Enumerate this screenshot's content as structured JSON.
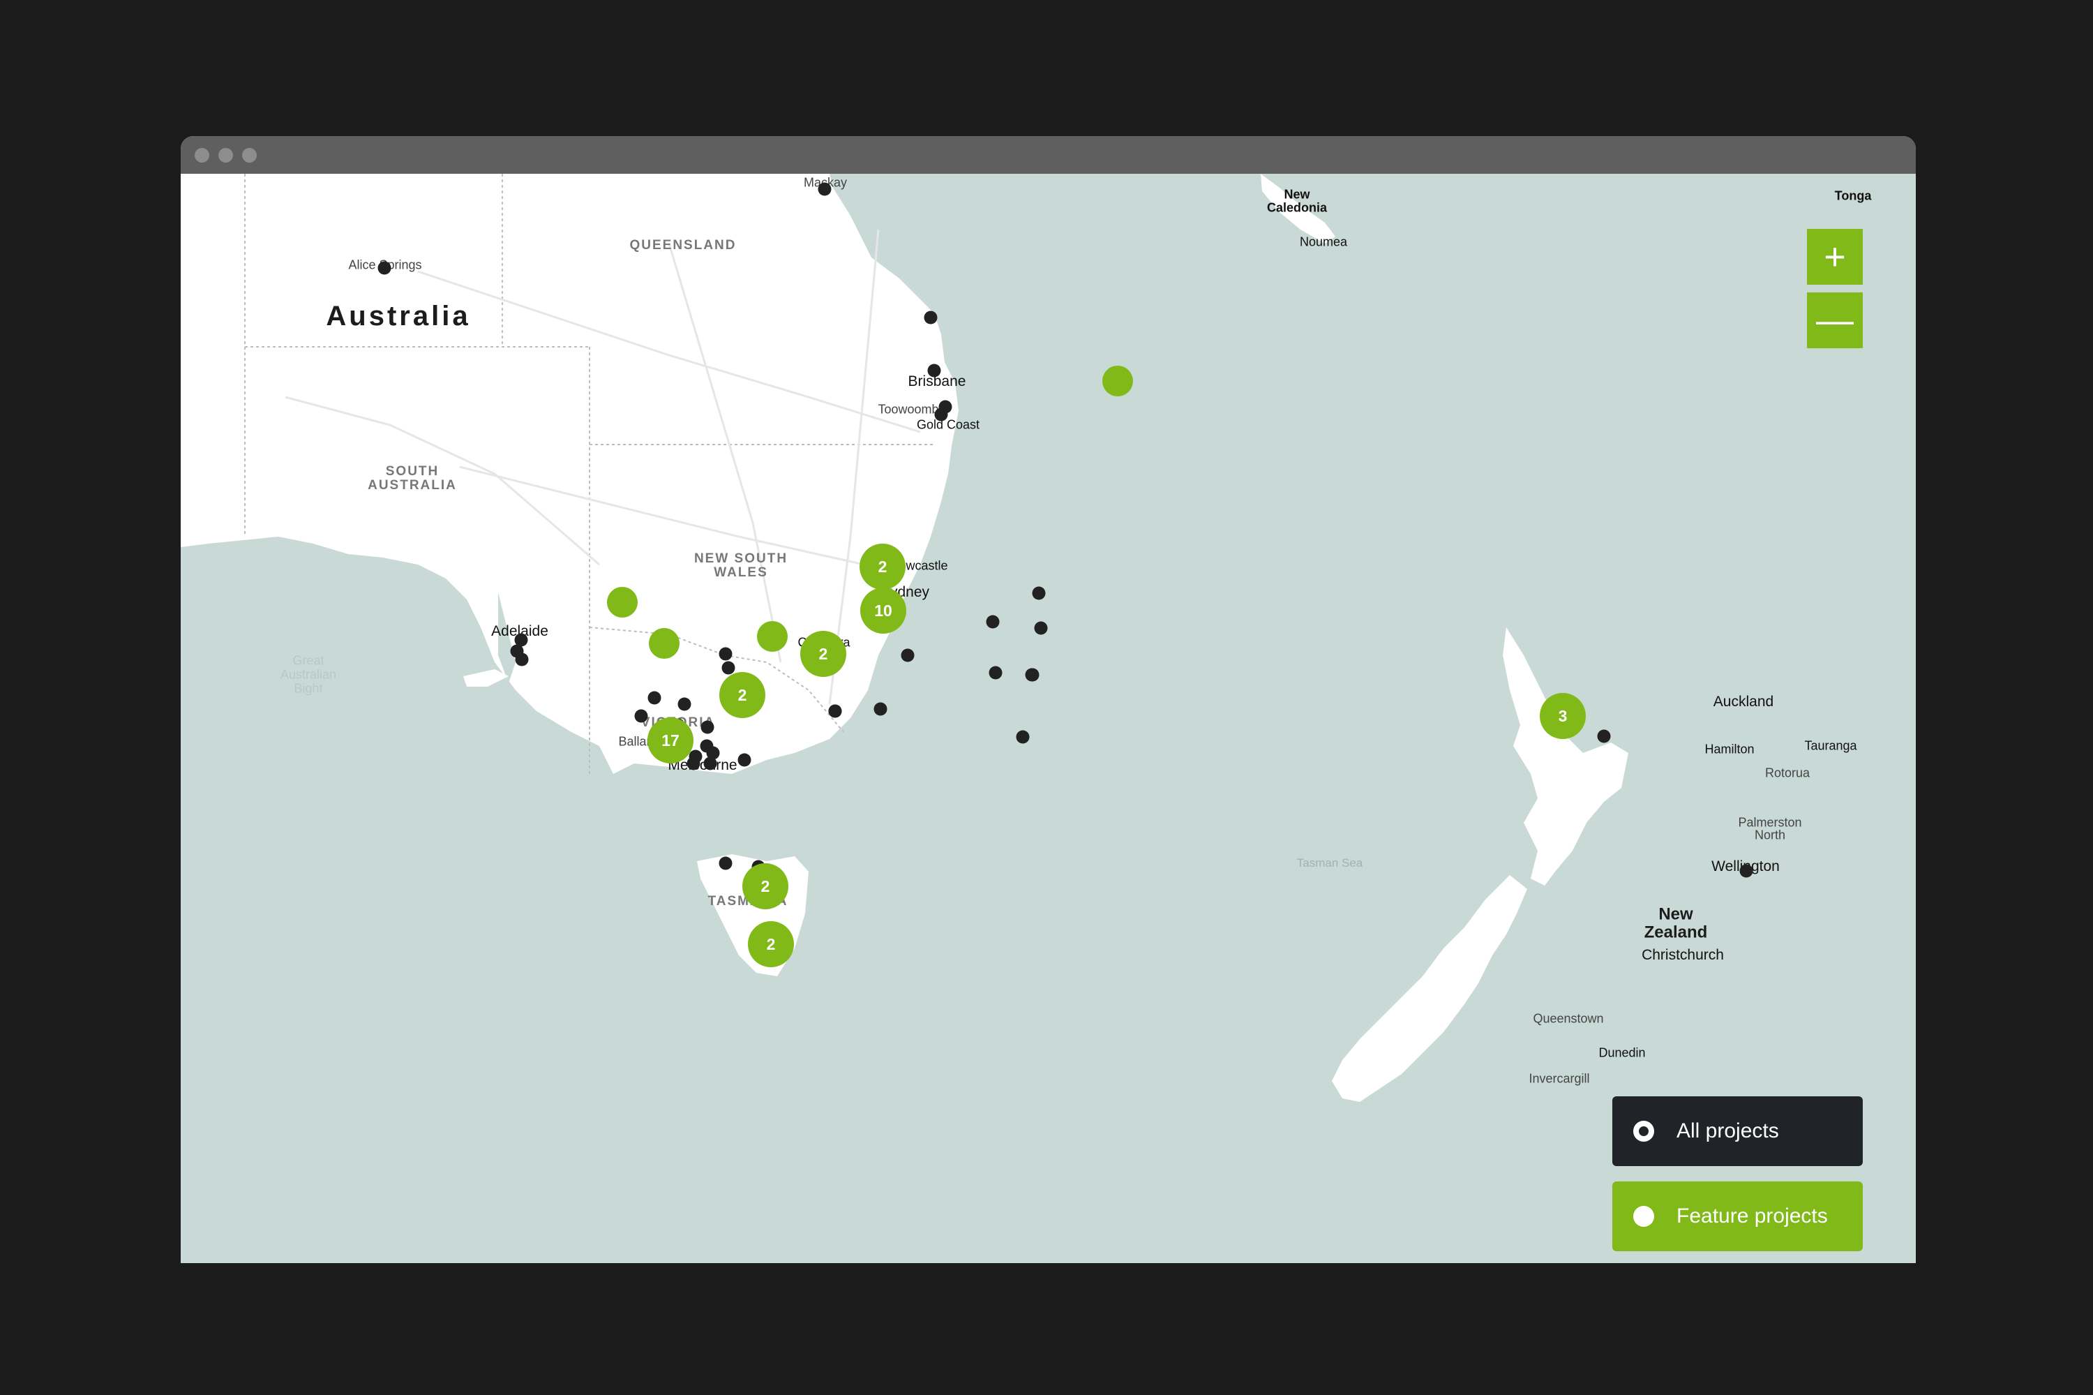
{
  "window": {
    "title_dots": [
      "close",
      "minimize",
      "maximize"
    ]
  },
  "map": {
    "country_label": "Australia",
    "nz_label_1": "New",
    "nz_label_2": "Zealand",
    "regions": {
      "qld": "QUEENSLAND",
      "sa_1": "SOUTH",
      "sa_2": "AUSTRALIA",
      "nsw_1": "NEW SOUTH",
      "nsw_2": "WALES",
      "vic": "VICTORIA",
      "tas": "TASMANIA"
    },
    "places": {
      "mackay": "Mackay",
      "alice_springs": "Alice Springs",
      "brisbane": "Brisbane",
      "toowoomba": "Toowoomba",
      "gold_coast": "Gold Coast",
      "newcastle": "Newcastle",
      "sydney": "Sydney",
      "canberra": "Canberra",
      "adelaide": "Adelaide",
      "ballarat": "Ballarat",
      "melbourne": "Melbourne",
      "new_caledonia_1": "New",
      "new_caledonia_2": "Caledonia",
      "noumea": "Noumea",
      "tonga": "Tonga",
      "auckland": "Auckland",
      "hamilton": "Hamilton",
      "tauranga": "Tauranga",
      "rotorua": "Rotorua",
      "palmerston_1": "Palmerston",
      "palmerston_2": "North",
      "wellington": "Wellington",
      "christchurch": "Christchurch",
      "queenstown": "Queenstown",
      "dunedin": "Dunedin",
      "invercargill": "Invercargill",
      "tasman_sea": "Tasman Sea",
      "bight_1": "Great",
      "bight_2": "Australian",
      "bight_3": "Bight"
    },
    "clusters": [
      "2",
      "10",
      "2",
      "2",
      "17",
      "2",
      "2",
      "3",
      "",
      "",
      "",
      ""
    ]
  },
  "controls": {
    "zoom_in": "+",
    "zoom_out": "—",
    "filters": {
      "all": "All projects",
      "feature": "Feature projects"
    }
  },
  "colors": {
    "accent": "#80b918",
    "water": "#c9d9d6",
    "land": "#ffffff",
    "dark_button": "#202428",
    "pin": "#222222"
  }
}
